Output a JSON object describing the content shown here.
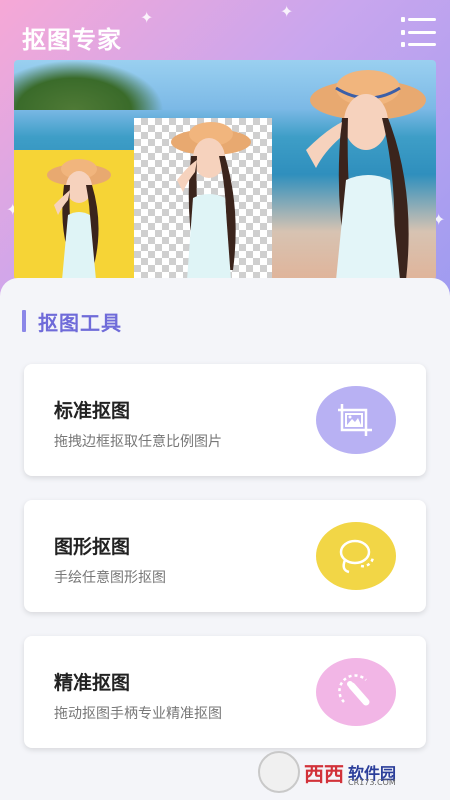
{
  "app": {
    "title": "抠图专家"
  },
  "header": {
    "menu_icon": "menu-list-icon"
  },
  "section": {
    "title": "抠图工具"
  },
  "tools": [
    {
      "title": "标准抠图",
      "description": "拖拽边框抠取任意比例图片",
      "icon": "crop-image-icon",
      "icon_color": "#b8b1f3"
    },
    {
      "title": "图形抠图",
      "description": "手绘任意图形抠图",
      "icon": "lasso-icon",
      "icon_color": "#f2d646"
    },
    {
      "title": "精准抠图",
      "description": "拖动抠图手柄专业精准抠图",
      "icon": "precise-cut-icon",
      "icon_color": "#f2b6e6"
    }
  ],
  "watermark": {
    "text_red": "西西",
    "text_blue": "软件园",
    "sub": "CR173.COM"
  },
  "colors": {
    "accent": "#6f6bd9",
    "header_gradient_start": "#f6a8d6",
    "header_gradient_end": "#9c9bf1"
  }
}
